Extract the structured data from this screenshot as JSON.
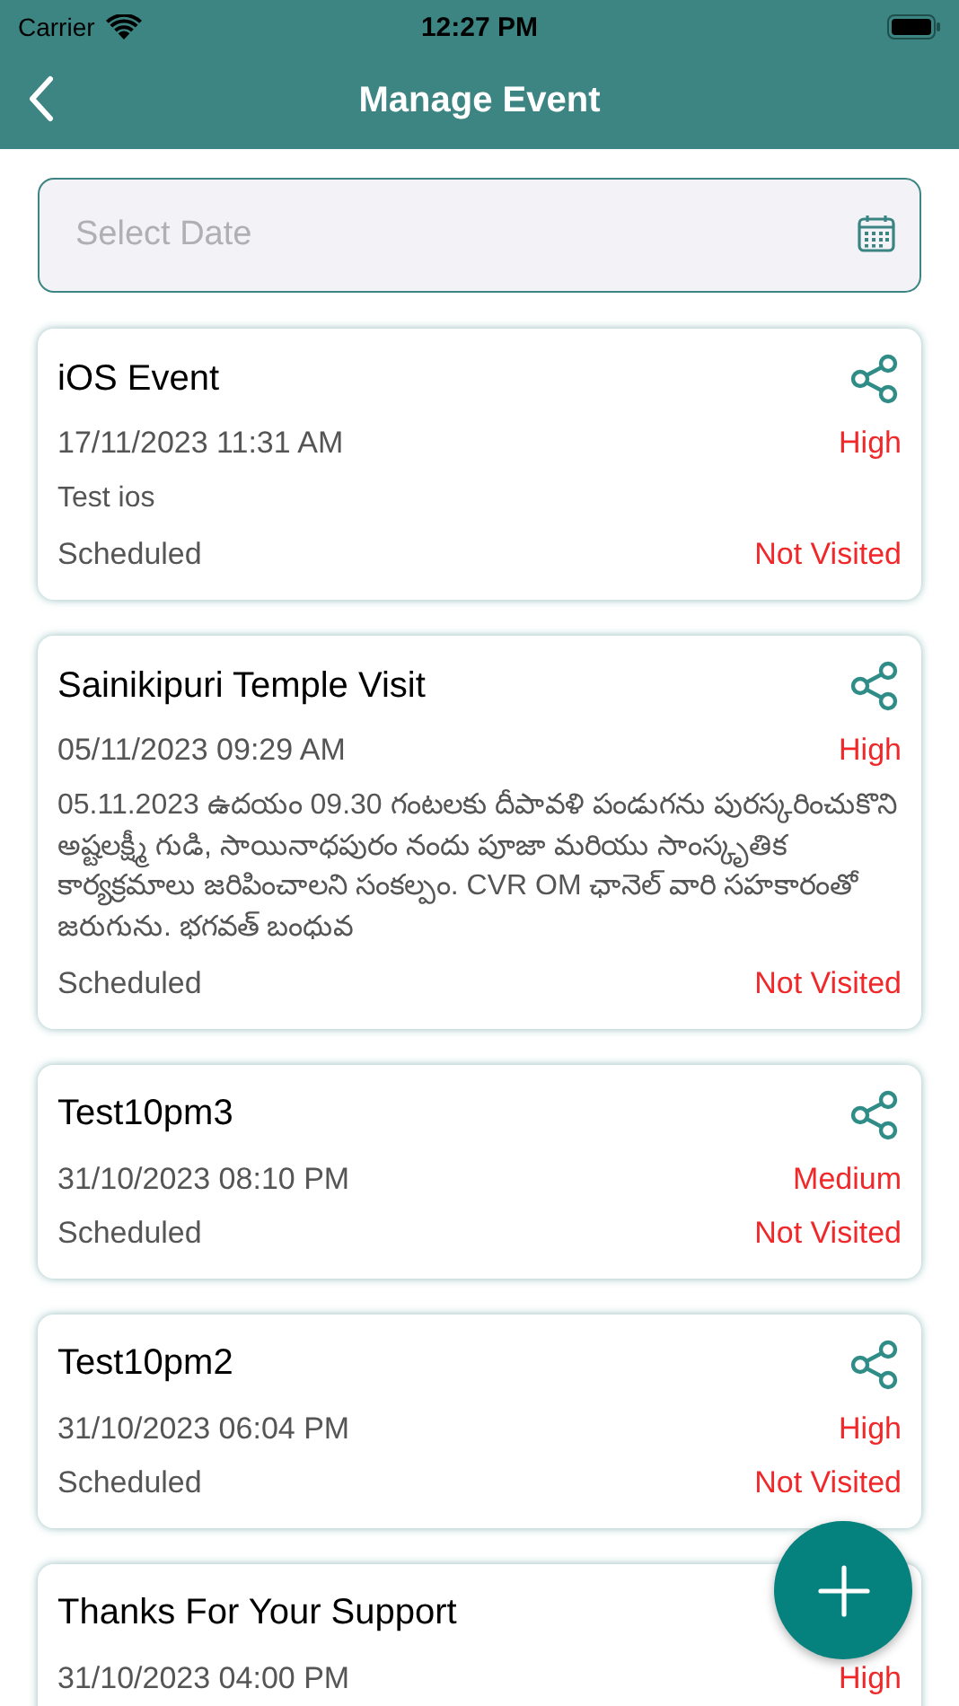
{
  "status_bar": {
    "carrier": "Carrier",
    "time": "12:27 PM"
  },
  "header": {
    "title": "Manage Event"
  },
  "date_field": {
    "placeholder": "Select Date"
  },
  "events": [
    {
      "title": "iOS Event",
      "datetime": "17/11/2023 11:31 AM",
      "priority": "High",
      "description": "Test ios",
      "schedule": "Scheduled",
      "visit_status": "Not Visited"
    },
    {
      "title": "Sainikipuri Temple Visit",
      "datetime": "05/11/2023 09:29 AM",
      "priority": "High",
      "description": "05.11.2023 ఉదయం 09.30 గంటలకు దీపావళి పండుగను పురస్కరించుకొని అష్టలక్ష్మీ గుడి, సాయినాధపురం నందు పూజా మరియు సాంస్కృతిక కార్యక్రమాలు జరిపించాలని సంకల్పం. CVR OM ఛానెల్ వారి సహకారంతో జరుగును. భగవత్ బంధువ",
      "schedule": "Scheduled",
      "visit_status": "Not Visited"
    },
    {
      "title": "Test10pm3",
      "datetime": "31/10/2023 08:10 PM",
      "priority": "Medium",
      "schedule": "Scheduled",
      "visit_status": "Not Visited"
    },
    {
      "title": "Test10pm2",
      "datetime": "31/10/2023 06:04 PM",
      "priority": "High",
      "schedule": "Scheduled",
      "visit_status": "Not Visited"
    },
    {
      "title": "Thanks For Your Support",
      "datetime": "31/10/2023 04:00 PM",
      "priority": "High"
    }
  ]
}
